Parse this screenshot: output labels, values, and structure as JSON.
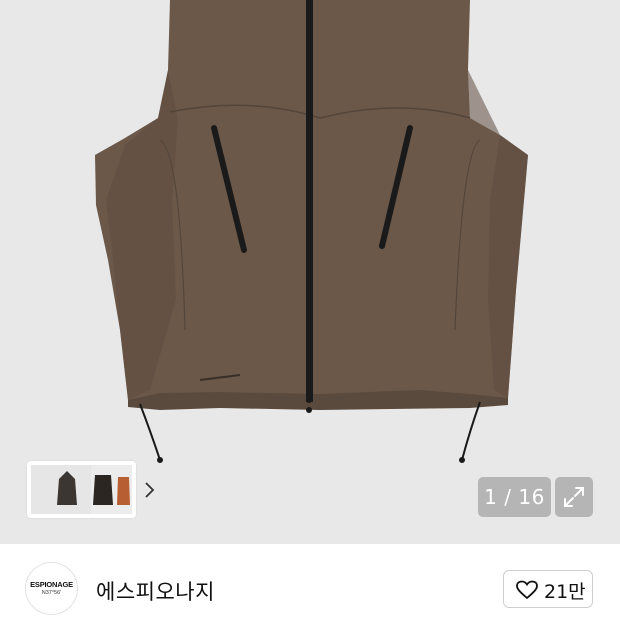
{
  "product_image": {
    "alt": "brown sleeveless zip vest",
    "icon": "product-photo",
    "colors": {
      "background": "#e8e8e8",
      "vest": "#6b5849",
      "zipper": "#1a1a1a"
    }
  },
  "thumbnails": {
    "items": [
      "thumbnail-hooded-vest",
      "thumbnail-dark-vest",
      "thumbnail-orange-vest"
    ],
    "more_icon": "chevron-right-icon"
  },
  "gallery": {
    "counter": "1 / 16",
    "expand_icon": "expand-icon"
  },
  "seller": {
    "logo_text": "ESPIONAGE",
    "logo_subtext": "N37°56'",
    "name": "에스피오나지"
  },
  "like": {
    "icon": "heart-icon",
    "count": "21만"
  }
}
